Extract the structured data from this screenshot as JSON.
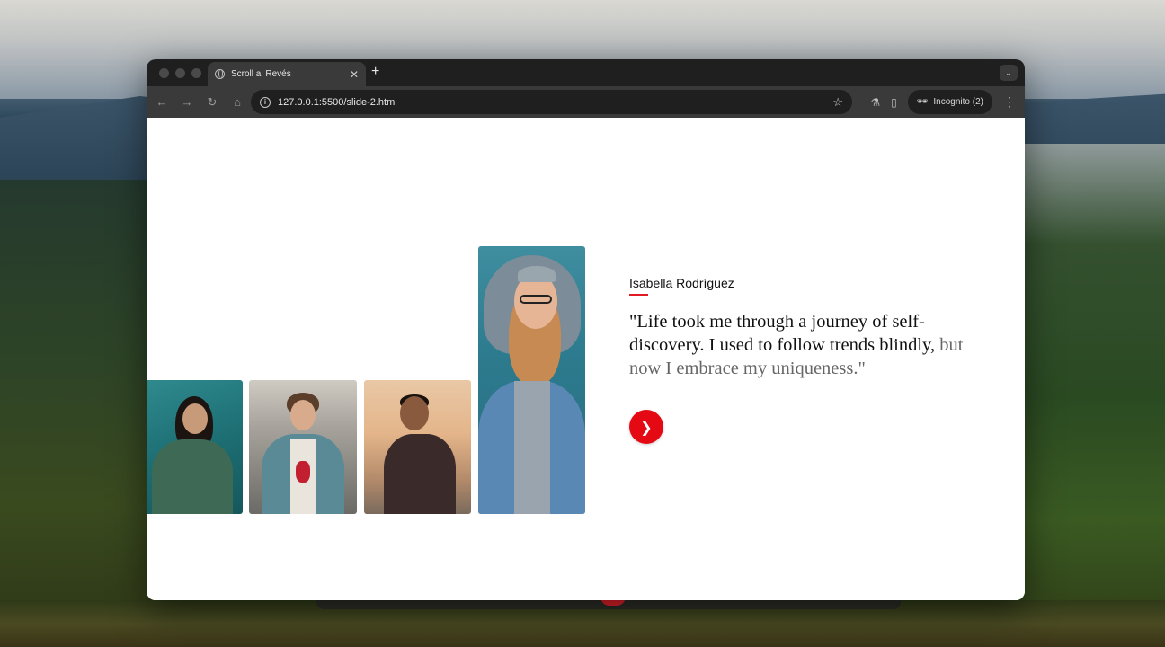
{
  "browser": {
    "tab_title": "Scroll al Revés",
    "url": "127.0.0.1:5500/slide-2.html",
    "incognito_label": "Incognito (2)",
    "new_tab_symbol": "+",
    "close_symbol": "✕"
  },
  "icons": {
    "back": "back-arrow-icon",
    "forward": "forward-arrow-icon",
    "reload": "reload-icon",
    "home": "home-icon",
    "site_info": "info-icon",
    "bookmark": "star-icon",
    "labs": "flask-icon",
    "side_panel": "side-panel-icon",
    "incognito": "incognito-icon",
    "menu": "kebab-menu-icon",
    "tab_search": "chevron-down-icon",
    "next": "chevron-right-icon"
  },
  "testimonial": {
    "name": "Isabella Rodríguez",
    "quote_main": "\"Life took me through a journey of self-discovery. I used to follow trends blindly,",
    "quote_fade": "but now I embrace my uniqueness.\""
  },
  "colors": {
    "accent": "#e50914",
    "underline": "#e01b24",
    "text": "#111111"
  }
}
